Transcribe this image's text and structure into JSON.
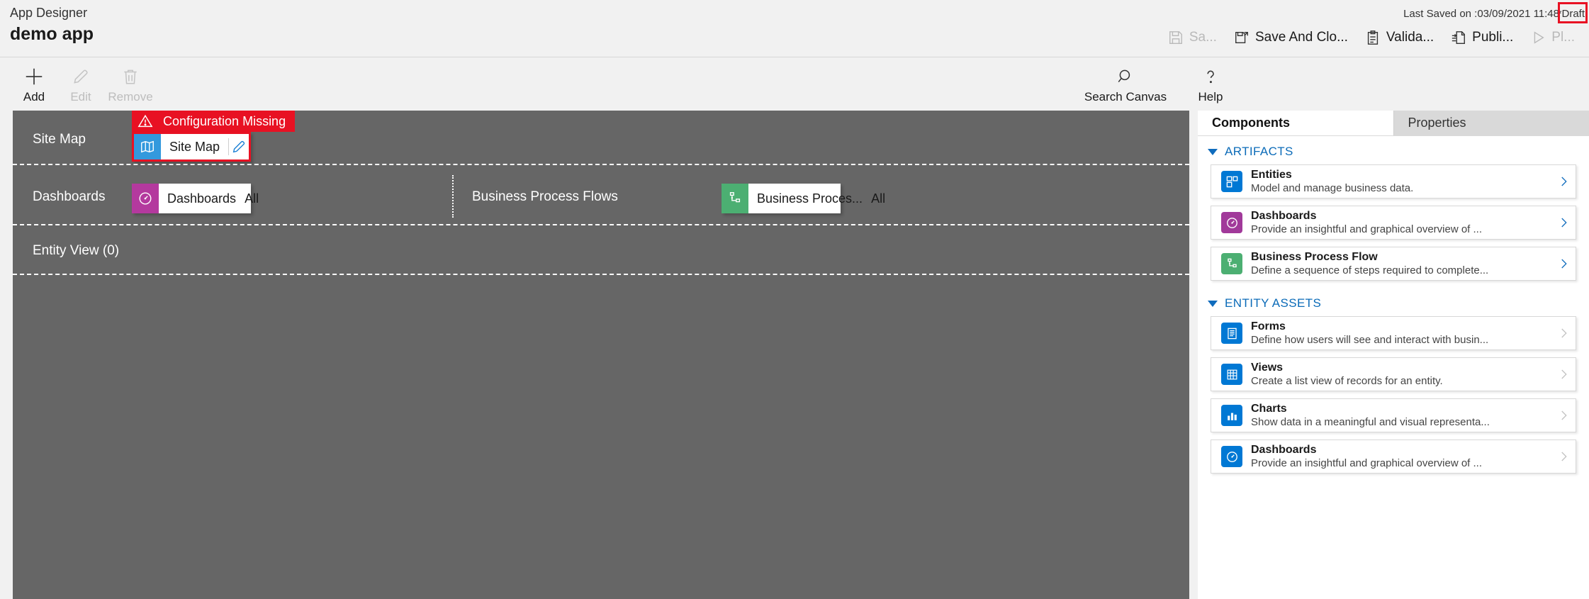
{
  "header": {
    "subtitle": "App Designer",
    "title": "demo app",
    "last_saved": "Last Saved on :03/09/2021 11:48",
    "draft_status": "*Draft",
    "draft_highlight_color": "#e81123",
    "commands": [
      {
        "label": "Sa...",
        "icon": "save-icon",
        "disabled": true
      },
      {
        "label": "Save And Clo...",
        "icon": "save-and-close-icon",
        "disabled": false
      },
      {
        "label": "Valida...",
        "icon": "validate-icon",
        "disabled": false
      },
      {
        "label": "Publi...",
        "icon": "publish-icon",
        "disabled": false
      },
      {
        "label": "Pl...",
        "icon": "play-icon",
        "disabled": true
      }
    ]
  },
  "toolbar": {
    "items": [
      {
        "label": "Add",
        "icon": "plus-icon",
        "disabled": false
      },
      {
        "label": "Edit",
        "icon": "pencil-icon",
        "disabled": true
      },
      {
        "label": "Remove",
        "icon": "trash-icon",
        "disabled": true
      }
    ],
    "right_items": [
      {
        "label": "Search Canvas",
        "icon": "search-icon",
        "disabled": false
      },
      {
        "label": "Help",
        "icon": "question-icon",
        "disabled": false
      }
    ]
  },
  "canvas": {
    "rows": [
      {
        "label": "Site Map",
        "warning": {
          "text": "Configuration Missing",
          "icon": "warning-triangle-icon",
          "color": "#e81123"
        },
        "tile": {
          "name": "Site Map",
          "icon": "map-icon",
          "icon_color": "#3399dd",
          "has_edit": true,
          "edit_icon": "pencil-icon",
          "selected": true
        }
      },
      {
        "label": "Dashboards",
        "tile": {
          "name": "Dashboards",
          "icon": "dashboard-gauge-icon",
          "icon_color": "#b4399e",
          "all_label": "All"
        },
        "label2": "Business Process Flows",
        "tile2": {
          "name": "Business Proces...",
          "icon": "process-flow-icon",
          "icon_color": "#4caf72",
          "all_label": "All"
        }
      },
      {
        "label": "Entity View (0)"
      }
    ]
  },
  "panel": {
    "tabs": [
      {
        "label": "Components",
        "active": true
      },
      {
        "label": "Properties",
        "active": false
      }
    ],
    "groups": [
      {
        "title": "ARTIFACTS",
        "expanded": true,
        "cards": [
          {
            "title": "Entities",
            "desc": "Model and manage business data.",
            "icon": "entities-icon",
            "icon_color": "#0078d4",
            "chevron": "chevron-right-icon",
            "chevron_active": true
          },
          {
            "title": "Dashboards",
            "desc": "Provide an insightful and graphical overview of ...",
            "icon": "dashboard-gauge-icon",
            "icon_color": "#a1399a",
            "chevron": "chevron-right-icon",
            "chevron_active": true
          },
          {
            "title": "Business Process Flow",
            "desc": "Define a sequence of steps required to complete...",
            "icon": "process-flow-icon",
            "icon_color": "#4caf72",
            "chevron": "chevron-right-icon",
            "chevron_active": true
          }
        ]
      },
      {
        "title": "ENTITY ASSETS",
        "expanded": true,
        "cards": [
          {
            "title": "Forms",
            "desc": "Define how users will see and interact with busin...",
            "icon": "forms-icon",
            "icon_color": "#0078d4",
            "chevron": "chevron-right-icon",
            "chevron_active": false
          },
          {
            "title": "Views",
            "desc": "Create a list view of records for an entity.",
            "icon": "views-grid-icon",
            "icon_color": "#0078d4",
            "chevron": "chevron-right-icon",
            "chevron_active": false
          },
          {
            "title": "Charts",
            "desc": "Show data in a meaningful and visual representa...",
            "icon": "charts-bar-icon",
            "icon_color": "#0078d4",
            "chevron": "chevron-right-icon",
            "chevron_active": false
          },
          {
            "title": "Dashboards",
            "desc": "Provide an insightful and graphical overview of ...",
            "icon": "dashboard-gauge-icon",
            "icon_color": "#0078d4",
            "chevron": "chevron-right-icon",
            "chevron_active": false
          }
        ]
      }
    ]
  }
}
